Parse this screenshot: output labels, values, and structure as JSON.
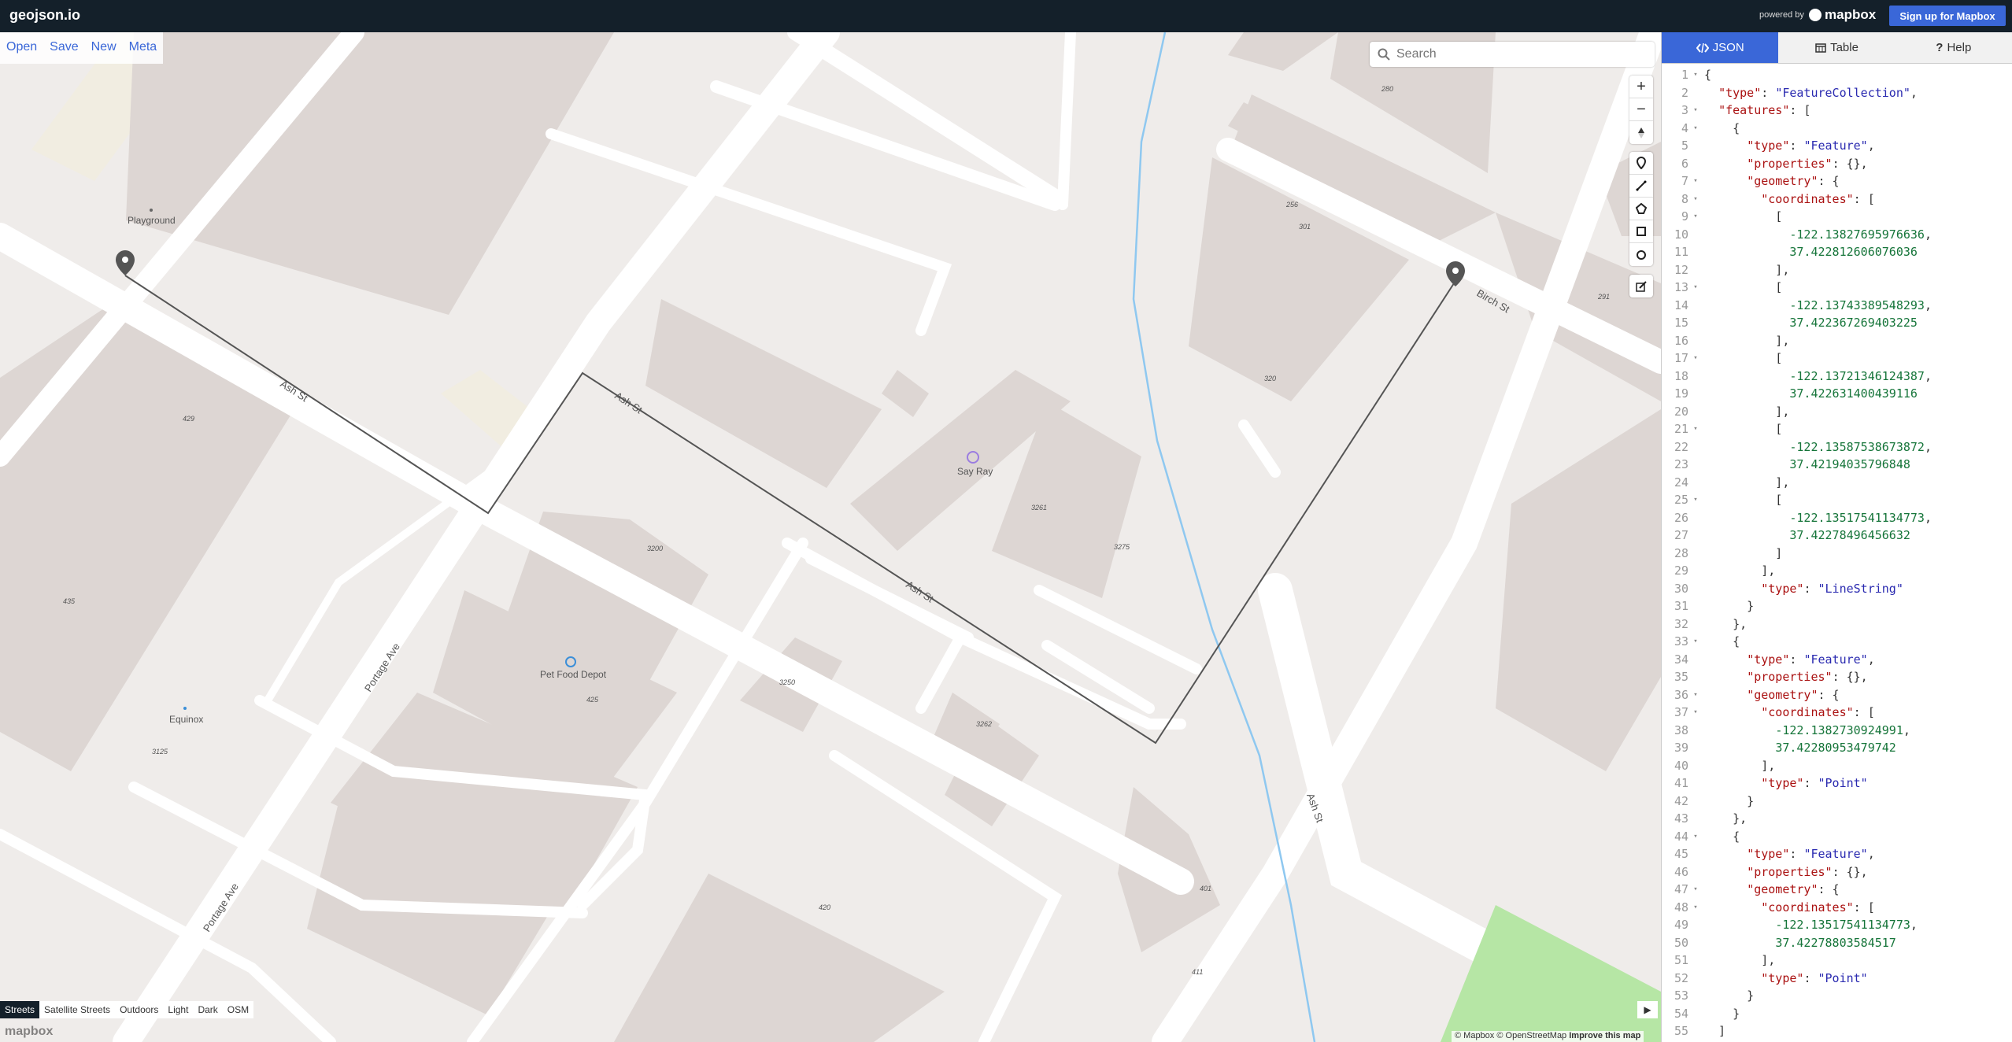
{
  "app": {
    "title": "geojson.io",
    "powered_by": "powered by",
    "mapbox_logo": "mapbox",
    "signup": "Sign up for Mapbox"
  },
  "file_menu": [
    "Open",
    "Save",
    "New",
    "Meta"
  ],
  "search": {
    "placeholder": "Search"
  },
  "map": {
    "zoom_controls": {
      "zoom_in": "+",
      "zoom_out": "−"
    },
    "draw_tools": [
      "marker-icon",
      "line-icon",
      "polygon-icon",
      "rectangle-icon",
      "circle-icon",
      "edit-icon"
    ],
    "styles": [
      "Streets",
      "Satellite Streets",
      "Outdoors",
      "Light",
      "Dark",
      "OSM"
    ],
    "active_style": "Streets",
    "watermark": "mapbox",
    "attribution": {
      "mapbox": "© Mapbox",
      "osm": "© OpenStreetMap",
      "improve": "Improve this map"
    },
    "labels": {
      "playground": "Playground",
      "ash_st": "Ash St",
      "birch_st": "Birch St",
      "portage_ave": "Portage Ave",
      "say_ray": "Say Ray",
      "pet_food_depot": "Pet Food Depot",
      "equinox": "Equinox"
    },
    "house_numbers": [
      "280",
      "256",
      "301",
      "291",
      "320",
      "429",
      "435",
      "3261",
      "3275",
      "3200",
      "3250",
      "3262",
      "425",
      "3125",
      "420",
      "401",
      "411"
    ]
  },
  "panel": {
    "tabs": [
      {
        "label": "JSON",
        "icon": "code-icon"
      },
      {
        "label": "Table",
        "icon": "table-icon"
      },
      {
        "label": "Help",
        "icon": "help-icon"
      }
    ],
    "active_tab": "JSON"
  },
  "geojson_lines": [
    {
      "n": "1",
      "f": "▾",
      "t": "{"
    },
    {
      "n": "2",
      "f": "",
      "t": "  \"type\": \"FeatureCollection\","
    },
    {
      "n": "3",
      "f": "▾",
      "t": "  \"features\": ["
    },
    {
      "n": "4",
      "f": "▾",
      "t": "    {"
    },
    {
      "n": "5",
      "f": "",
      "t": "      \"type\": \"Feature\","
    },
    {
      "n": "6",
      "f": "",
      "t": "      \"properties\": {},"
    },
    {
      "n": "7",
      "f": "▾",
      "t": "      \"geometry\": {"
    },
    {
      "n": "8",
      "f": "▾",
      "t": "        \"coordinates\": ["
    },
    {
      "n": "9",
      "f": "▾",
      "t": "          ["
    },
    {
      "n": "10",
      "f": "",
      "t": "            -122.13827695976636,"
    },
    {
      "n": "11",
      "f": "",
      "t": "            37.422812606076036"
    },
    {
      "n": "12",
      "f": "",
      "t": "          ],"
    },
    {
      "n": "13",
      "f": "▾",
      "t": "          ["
    },
    {
      "n": "14",
      "f": "",
      "t": "            -122.13743389548293,"
    },
    {
      "n": "15",
      "f": "",
      "t": "            37.422367269403225"
    },
    {
      "n": "16",
      "f": "",
      "t": "          ],"
    },
    {
      "n": "17",
      "f": "▾",
      "t": "          ["
    },
    {
      "n": "18",
      "f": "",
      "t": "            -122.13721346124387,"
    },
    {
      "n": "19",
      "f": "",
      "t": "            37.422631400439116"
    },
    {
      "n": "20",
      "f": "",
      "t": "          ],"
    },
    {
      "n": "21",
      "f": "▾",
      "t": "          ["
    },
    {
      "n": "22",
      "f": "",
      "t": "            -122.13587538673872,"
    },
    {
      "n": "23",
      "f": "",
      "t": "            37.42194035796848"
    },
    {
      "n": "24",
      "f": "",
      "t": "          ],"
    },
    {
      "n": "25",
      "f": "▾",
      "t": "          ["
    },
    {
      "n": "26",
      "f": "",
      "t": "            -122.13517541134773,"
    },
    {
      "n": "27",
      "f": "",
      "t": "            37.42278496456632"
    },
    {
      "n": "28",
      "f": "",
      "t": "          ]"
    },
    {
      "n": "29",
      "f": "",
      "t": "        ],"
    },
    {
      "n": "30",
      "f": "",
      "t": "        \"type\": \"LineString\""
    },
    {
      "n": "31",
      "f": "",
      "t": "      }"
    },
    {
      "n": "32",
      "f": "",
      "t": "    },"
    },
    {
      "n": "33",
      "f": "▾",
      "t": "    {"
    },
    {
      "n": "34",
      "f": "",
      "t": "      \"type\": \"Feature\","
    },
    {
      "n": "35",
      "f": "",
      "t": "      \"properties\": {},"
    },
    {
      "n": "36",
      "f": "▾",
      "t": "      \"geometry\": {"
    },
    {
      "n": "37",
      "f": "▾",
      "t": "        \"coordinates\": ["
    },
    {
      "n": "38",
      "f": "",
      "t": "          -122.1382730924991,"
    },
    {
      "n": "39",
      "f": "",
      "t": "          37.42280953479742"
    },
    {
      "n": "40",
      "f": "",
      "t": "        ],"
    },
    {
      "n": "41",
      "f": "",
      "t": "        \"type\": \"Point\""
    },
    {
      "n": "42",
      "f": "",
      "t": "      }"
    },
    {
      "n": "43",
      "f": "",
      "t": "    },"
    },
    {
      "n": "44",
      "f": "▾",
      "t": "    {"
    },
    {
      "n": "45",
      "f": "",
      "t": "      \"type\": \"Feature\","
    },
    {
      "n": "46",
      "f": "",
      "t": "      \"properties\": {},"
    },
    {
      "n": "47",
      "f": "▾",
      "t": "      \"geometry\": {"
    },
    {
      "n": "48",
      "f": "▾",
      "t": "        \"coordinates\": ["
    },
    {
      "n": "49",
      "f": "",
      "t": "          -122.13517541134773,"
    },
    {
      "n": "50",
      "f": "",
      "t": "          37.42278803584517"
    },
    {
      "n": "51",
      "f": "",
      "t": "        ],"
    },
    {
      "n": "52",
      "f": "",
      "t": "        \"type\": \"Point\""
    },
    {
      "n": "53",
      "f": "",
      "t": "      }"
    },
    {
      "n": "54",
      "f": "",
      "t": "    }"
    },
    {
      "n": "55",
      "f": "",
      "t": "  ]"
    }
  ],
  "colors": {
    "topbar": "#14202a",
    "accent": "#3a67d8",
    "map_bg": "#efecea",
    "building": "#ddd6d3",
    "road": "#ffffff",
    "water": "#8fc8f0",
    "park": "#b6e6a5"
  }
}
